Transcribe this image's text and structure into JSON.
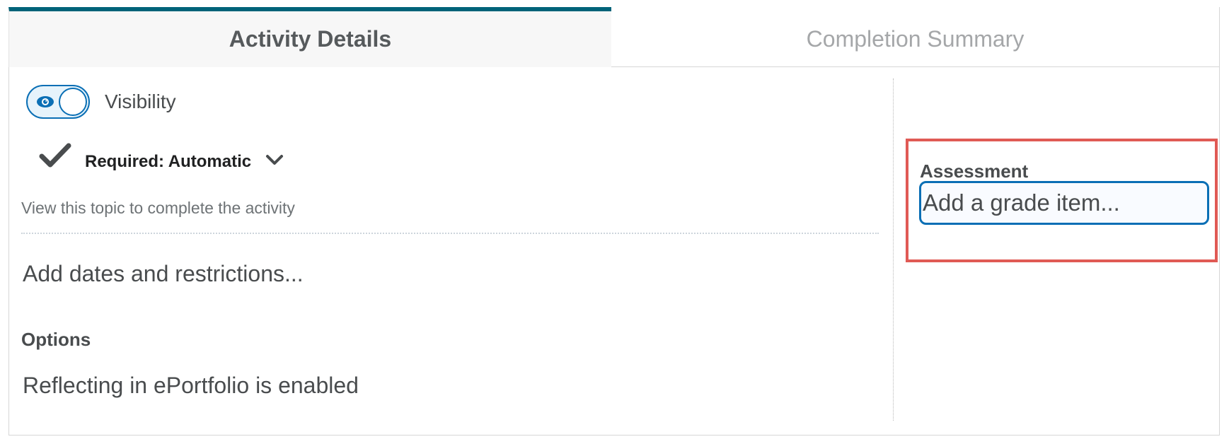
{
  "tabs": [
    {
      "label": "Activity Details",
      "active": true
    },
    {
      "label": "Completion Summary",
      "active": false
    }
  ],
  "visibility": {
    "label": "Visibility",
    "enabled": true,
    "icon": "eye-icon"
  },
  "completion": {
    "label": "Required: Automatic",
    "helper": "View this topic to complete the activity",
    "icon": "checkmark-icon",
    "dropdown_icon": "chevron-down-icon"
  },
  "dates": {
    "link_label": "Add dates and restrictions..."
  },
  "options": {
    "heading": "Options",
    "eportfolio": "Reflecting in ePortfolio is enabled"
  },
  "assessment": {
    "heading": "Assessment",
    "grade_item_label": "Add a grade item..."
  },
  "colors": {
    "accent": "#006379",
    "primary_blue": "#0a6fb5",
    "highlight": "#e05a55"
  }
}
